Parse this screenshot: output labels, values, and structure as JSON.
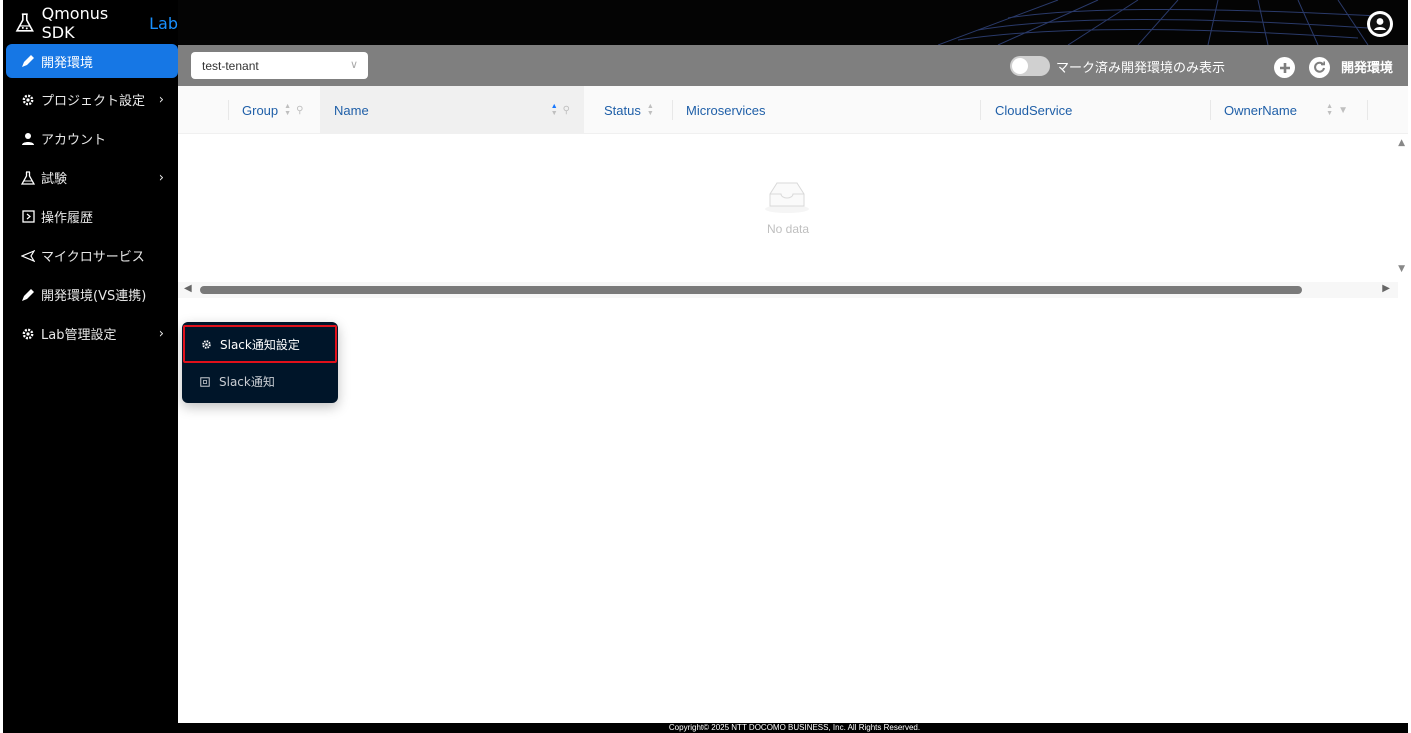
{
  "brand": {
    "name": "Qmonus SDK",
    "suffix": "Lab"
  },
  "sidebar": {
    "items": [
      {
        "label": "開発環境",
        "icon": "pen-icon",
        "active": true
      },
      {
        "label": "プロジェクト設定",
        "icon": "gear-icon",
        "has_submenu": true
      },
      {
        "label": "アカウント",
        "icon": "user-icon"
      },
      {
        "label": "試験",
        "icon": "flask-icon",
        "has_submenu": true
      },
      {
        "label": "操作履歴",
        "icon": "history-icon"
      },
      {
        "label": "マイクロサービス",
        "icon": "send-icon"
      },
      {
        "label": "開発環境(VS連携)",
        "icon": "pen-icon"
      },
      {
        "label": "Lab管理設定",
        "icon": "gear-icon",
        "has_submenu": true
      }
    ]
  },
  "submenu": {
    "items": [
      {
        "label": "Slack通知設定",
        "icon": "gear-icon",
        "highlighted": true
      },
      {
        "label": "Slack通知",
        "icon": "notice-icon"
      }
    ]
  },
  "filterbar": {
    "tenant": "test-tenant",
    "toggle_label": "マーク済み開発環境のみ表示",
    "env_label": "開発環境"
  },
  "table": {
    "columns": [
      "Group",
      "Name",
      "Status",
      "Microservices",
      "CloudService",
      "OwnerName"
    ],
    "empty_text": "No data"
  },
  "footer": {
    "copyright": "Copyright© 2025 NTT DOCOMO BUSINESS, Inc. All Rights Reserved."
  },
  "colors": {
    "accent": "#1677e5",
    "highlight": "#e0101a",
    "submenu_bg": "#001529"
  }
}
